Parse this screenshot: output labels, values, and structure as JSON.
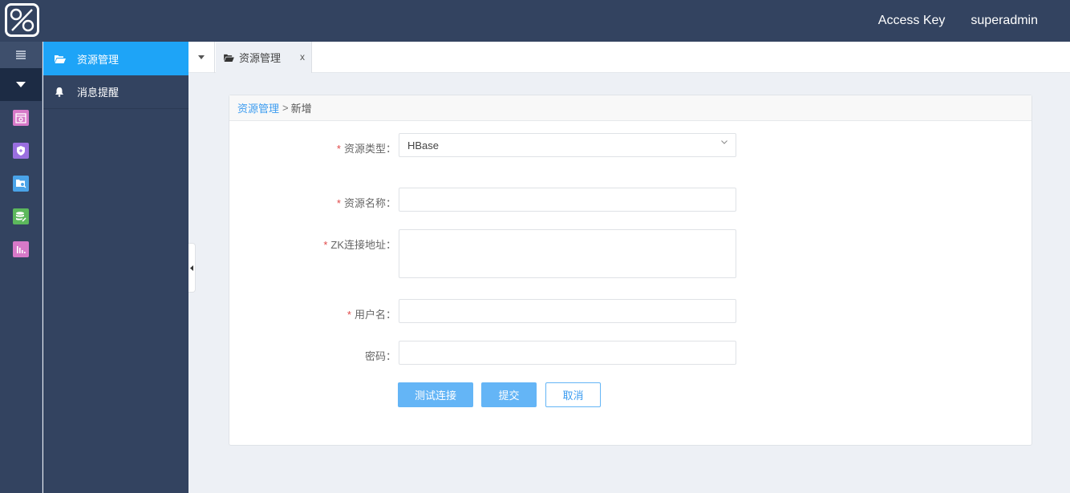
{
  "header": {
    "logo_icon": "percent-logo-icon",
    "links": [
      {
        "label": "Access Key"
      },
      {
        "label": "superadmin"
      }
    ]
  },
  "rail": {
    "toggle_icon": "menu-lines-icon",
    "expand_icon": "caret-down-icon",
    "items": [
      {
        "icon": "calendar-settings-icon",
        "color": "#d779c8"
      },
      {
        "icon": "shield-icon",
        "color": "#9a6fe0"
      },
      {
        "icon": "folder-search-icon",
        "color": "#4aa3e8"
      },
      {
        "icon": "database-edit-icon",
        "color": "#5cb85c"
      },
      {
        "icon": "bar-chart-icon",
        "color": "#d779c8"
      }
    ]
  },
  "nav": {
    "items": [
      {
        "label": "资源管理",
        "icon": "folder-open-icon",
        "active": true
      },
      {
        "label": "消息提醒",
        "icon": "bell-icon",
        "active": false
      }
    ]
  },
  "tabs": {
    "dropdown_icon": "caret-down-icon",
    "items": [
      {
        "label": "资源管理",
        "icon": "folder-open-icon",
        "close": "x"
      }
    ]
  },
  "breadcrumb": {
    "link": "资源管理",
    "separator": ">",
    "current": "新增"
  },
  "form": {
    "required_mark": "*",
    "fields": [
      {
        "label": "资源类型：",
        "required": true,
        "type": "select",
        "value": "HBase"
      },
      {
        "label": "资源名称：",
        "required": true,
        "type": "text",
        "value": ""
      },
      {
        "label": "ZK连接地址：",
        "required": true,
        "type": "textarea",
        "value": ""
      },
      {
        "label": "用户名：",
        "required": true,
        "type": "text",
        "value": ""
      },
      {
        "label": "密码：",
        "required": false,
        "type": "password",
        "value": ""
      }
    ],
    "buttons": {
      "test": "测试连接",
      "submit": "提交",
      "cancel": "取消"
    }
  },
  "colors": {
    "header_bg": "#334360",
    "active_nav": "#1ea4f7",
    "primary_button": "#64b5f6",
    "link": "#3c9cf0",
    "required": "#e04848"
  }
}
